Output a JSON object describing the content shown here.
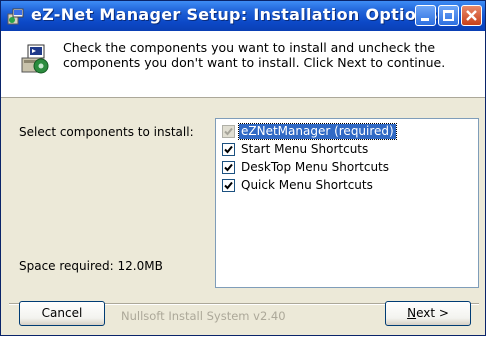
{
  "window": {
    "title": "eZ-Net Manager Setup: Installation Options",
    "controls": [
      "minimize-icon",
      "maximize-icon",
      "close-icon"
    ]
  },
  "header": {
    "instruction": "Check the components you want to install and uncheck the components you don't want to install. Click Next to continue.",
    "icon": "installer-package-icon"
  },
  "components": {
    "label": "Select components to install:",
    "items": [
      {
        "label": "eZNetManager (required)",
        "checked": true,
        "disabled": true,
        "selected": true
      },
      {
        "label": "Start Menu Shortcuts",
        "checked": true,
        "disabled": false,
        "selected": false
      },
      {
        "label": "DeskTop Menu Shortcuts",
        "checked": true,
        "disabled": false,
        "selected": false
      },
      {
        "label": "Quick Menu Shortcuts",
        "checked": true,
        "disabled": false,
        "selected": false
      }
    ]
  },
  "space": {
    "label": "Space required: 12.0MB"
  },
  "footer": {
    "branding": "Nullsoft Install System v2.40",
    "cancel_label": "Cancel",
    "next_label_prefix": "N",
    "next_label_rest": "ext >"
  },
  "colors": {
    "titlebar": "#0c49c7",
    "dialog_bg": "#ece9d8",
    "selection": "#316ac5"
  }
}
